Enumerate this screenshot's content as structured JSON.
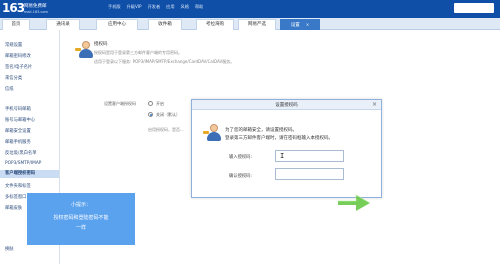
{
  "app": {
    "logo_number": "163",
    "logo_line1": "网易免费邮",
    "logo_line2": "mail.163.com"
  },
  "top_links": [
    "手机版",
    "升级VIP",
    "开发者",
    "应用",
    "风格",
    "帮助"
  ],
  "tabs": [
    {
      "label": "首页"
    },
    {
      "label": "通讯录"
    },
    {
      "label": "应用中心"
    },
    {
      "label": "收件箱"
    },
    {
      "label": "考拉海购"
    },
    {
      "label": "网易严选"
    },
    {
      "label": "设置",
      "close": "×"
    }
  ],
  "sidebar": {
    "items": [
      {
        "label": "常规设置"
      },
      {
        "label": "邮箱密码修改"
      },
      {
        "label": "签名/电子名片"
      },
      {
        "label": "来信分类"
      },
      {
        "label": "信纸"
      },
      {
        "label": "手机号码邮箱"
      },
      {
        "label": "账号与邮箱中心"
      },
      {
        "label": "邮箱安全设置"
      },
      {
        "label": "邮箱手机服务"
      },
      {
        "label": "反垃圾/黑白名单"
      },
      {
        "label": "POP3/SMTP/IMAP"
      },
      {
        "label": "客户端授权密码"
      },
      {
        "label": "文件夹和标签"
      },
      {
        "label": "多标签窗口"
      },
      {
        "label": "邮箱皮肤"
      },
      {
        "label": "换肤"
      }
    ]
  },
  "main": {
    "title": "授权码",
    "desc": "授权码是用于登录第三方邮件客户端的专用密码。",
    "desc2": "适用于登录以下服务: POP3/IMAP/SMTP/Exchange/CardDAV/CalDAV服务。",
    "option_label": "设置客户端授权码",
    "radio_on": "开启",
    "radio_off": "关闭（默认）",
    "note": "启用授权码，是否..."
  },
  "modal": {
    "title": "设置授权码",
    "close": "×",
    "text1": "为了您的邮箱安全，请设置授权码。",
    "text2": "登录第三方邮件客户端时，请在密码框输入本授权码。",
    "field1_label": "输入授权码:",
    "field1_value": "I",
    "field2_label": "确认授权码:"
  },
  "tip": {
    "title": "小提示：",
    "line1": "授权密码和登陆密码不能",
    "line2": "一样"
  },
  "colors": {
    "topbar": "#0f4fa8",
    "active_tab": "#3a79c8",
    "tip_bg": "#5aa1ee",
    "arrow": "#5ec43a"
  }
}
